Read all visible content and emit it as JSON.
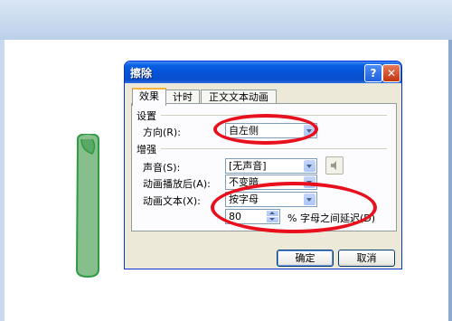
{
  "dialog": {
    "title": "擦除",
    "help_glyph": "?",
    "close_glyph": "✕"
  },
  "tabs": [
    {
      "label": "效果",
      "active": true
    },
    {
      "label": "计时",
      "active": false
    },
    {
      "label": "正文文本动画",
      "active": false
    }
  ],
  "settings": {
    "group_label": "设置",
    "direction_label": "方向(R):",
    "direction_value": "自左侧"
  },
  "enhancements": {
    "group_label": "增强",
    "sound_label": "声音(S):",
    "sound_value": "[无声音]",
    "after_anim_label": "动画播放后(A):",
    "after_anim_value": "不变暗",
    "animate_text_label": "动画文本(X):",
    "animate_text_value": "按字母",
    "delay_value": "80",
    "delay_suffix": "% 字母之间延迟(D)"
  },
  "buttons": {
    "ok": "确定",
    "cancel": "取消"
  },
  "colors": {
    "titlebar": "#0553d8",
    "dialog_bg": "#ece9d8",
    "highlight_ellipse": "#e8101c",
    "scroll_shape_fill": "#86bf8c",
    "scroll_shape_stroke": "#2f9a44"
  },
  "icons": {
    "sound_preview": "speaker-icon"
  }
}
